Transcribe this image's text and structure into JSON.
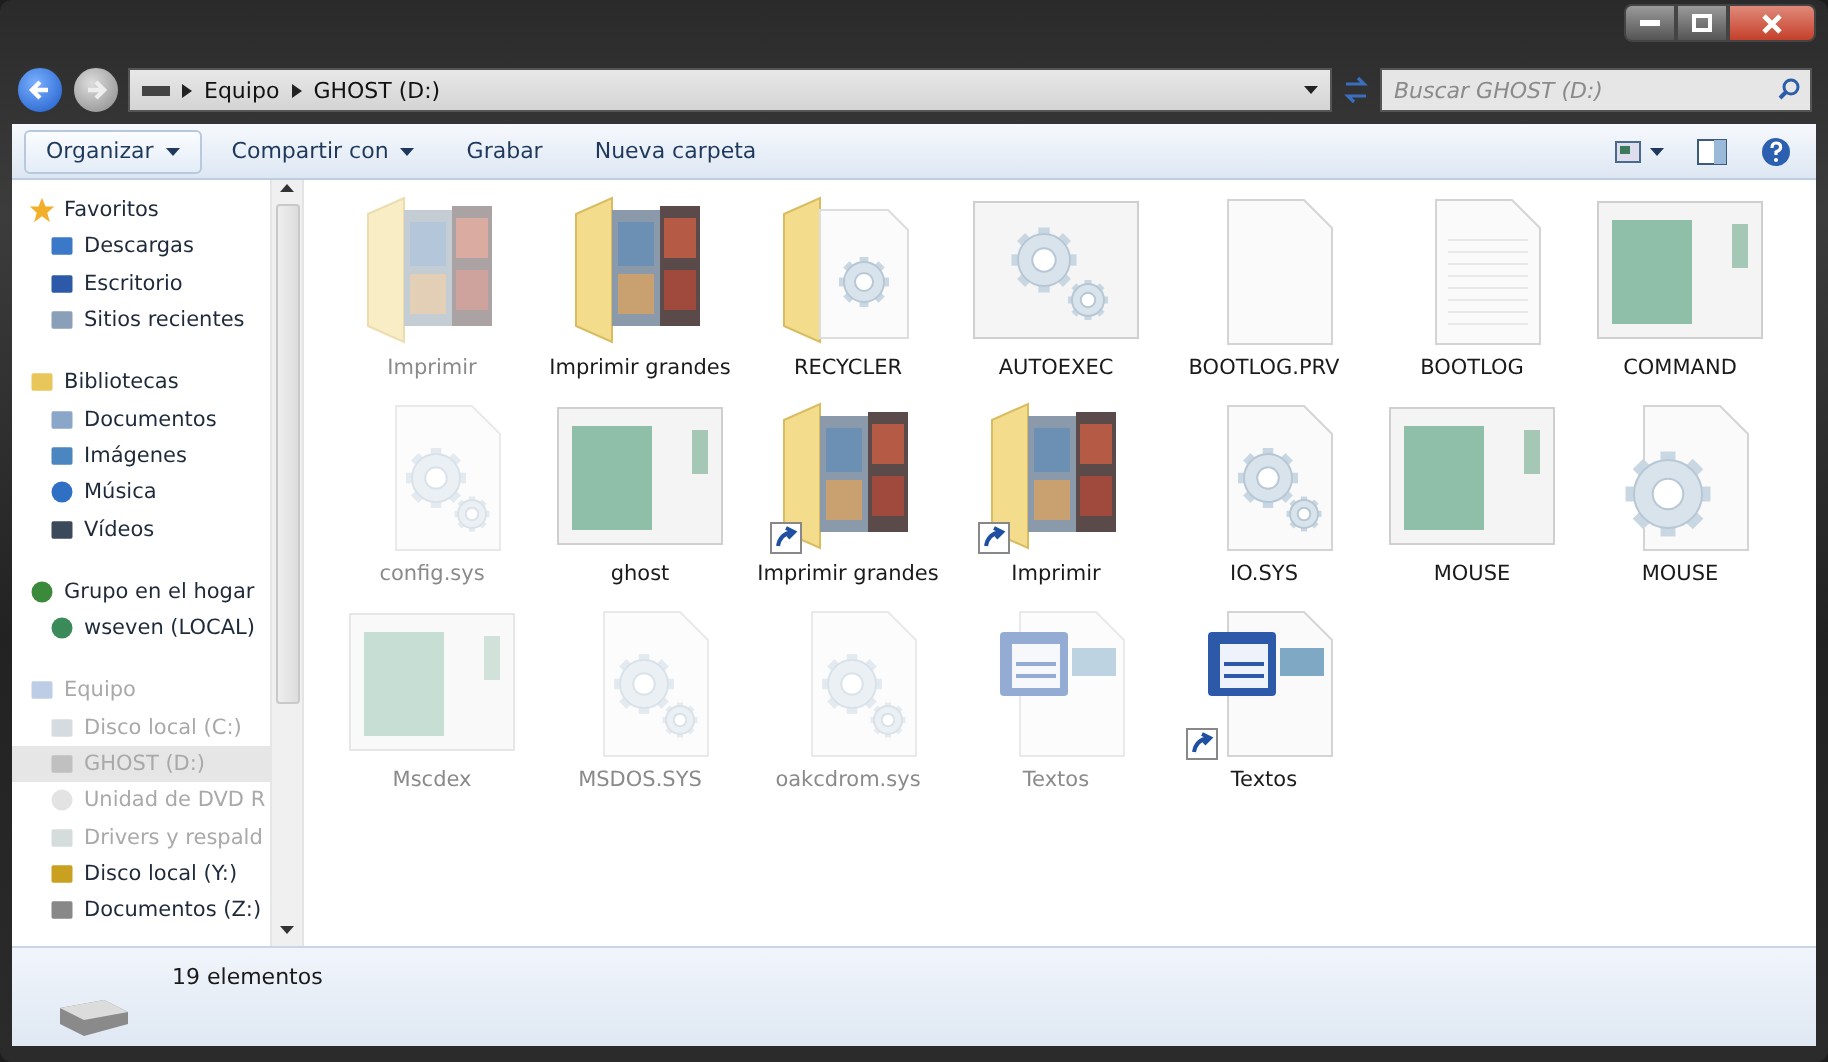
{
  "address": {
    "path": [
      "Equipo",
      "GHOST (D:)"
    ]
  },
  "search": {
    "placeholder": "Buscar GHOST (D:)"
  },
  "toolbar": [
    {
      "label": "Organizar",
      "dropdown": true
    },
    {
      "label": "Compartir con",
      "dropdown": true
    },
    {
      "label": "Grabar",
      "dropdown": false
    },
    {
      "label": "Nueva carpeta",
      "dropdown": false
    }
  ],
  "sidebar": [
    {
      "label": "Favoritos",
      "kind": "star",
      "disabled": false,
      "children": [
        {
          "label": "Descargas",
          "kind": "downloads",
          "disabled": false,
          "selected": false
        },
        {
          "label": "Escritorio",
          "kind": "desktop",
          "disabled": false,
          "selected": false
        },
        {
          "label": "Sitios recientes",
          "kind": "recent",
          "disabled": false,
          "selected": false
        }
      ]
    },
    {
      "label": "Bibliotecas",
      "kind": "library",
      "disabled": false,
      "children": [
        {
          "label": "Documentos",
          "kind": "document",
          "disabled": false,
          "selected": false
        },
        {
          "label": "Imágenes",
          "kind": "picture",
          "disabled": false,
          "selected": false
        },
        {
          "label": "Música",
          "kind": "music",
          "disabled": false,
          "selected": false
        },
        {
          "label": "Vídeos",
          "kind": "video",
          "disabled": false,
          "selected": false
        }
      ]
    },
    {
      "label": "Grupo en el hogar",
      "kind": "homegroup",
      "disabled": false,
      "children": [
        {
          "label": "wseven (LOCAL)",
          "kind": "user",
          "disabled": false,
          "selected": false
        }
      ]
    },
    {
      "label": "Equipo",
      "kind": "computer",
      "disabled": true,
      "children": [
        {
          "label": "Disco local (C:)",
          "kind": "disk",
          "disabled": true,
          "selected": false
        },
        {
          "label": "GHOST (D:)",
          "kind": "drive",
          "disabled": true,
          "selected": true
        },
        {
          "label": "Unidad de DVD R",
          "kind": "dvd",
          "disabled": true,
          "selected": false
        },
        {
          "label": "Drivers y respald",
          "kind": "netdrive",
          "disabled": true,
          "selected": false
        },
        {
          "label": "Disco local (Y:)",
          "kind": "lockdisk",
          "disabled": false,
          "selected": false
        },
        {
          "label": "Documentos (Z:)",
          "kind": "drive",
          "disabled": false,
          "selected": false
        }
      ]
    }
  ],
  "files": [
    {
      "name": "Imprimir",
      "kind": "photo-folder",
      "hidden": true,
      "shortcut": false
    },
    {
      "name": "Imprimir grandes",
      "kind": "photo-folder",
      "hidden": false,
      "shortcut": false
    },
    {
      "name": "RECYCLER",
      "kind": "gear-folder",
      "hidden": false,
      "shortcut": false
    },
    {
      "name": "AUTOEXEC",
      "kind": "gear-window",
      "hidden": false,
      "shortcut": false
    },
    {
      "name": "BOOTLOG.PRV",
      "kind": "blank-file",
      "hidden": false,
      "shortcut": false
    },
    {
      "name": "BOOTLOG",
      "kind": "text-file",
      "hidden": false,
      "shortcut": false
    },
    {
      "name": "COMMAND",
      "kind": "app-window",
      "hidden": false,
      "shortcut": false
    },
    {
      "name": "config.sys",
      "kind": "gear-file",
      "hidden": true,
      "shortcut": false
    },
    {
      "name": "ghost",
      "kind": "app-window",
      "hidden": false,
      "shortcut": false
    },
    {
      "name": "Imprimir grandes",
      "kind": "photo-folder",
      "hidden": false,
      "shortcut": true
    },
    {
      "name": "Imprimir",
      "kind": "photo-folder",
      "hidden": false,
      "shortcut": true
    },
    {
      "name": "IO.SYS",
      "kind": "gear-file",
      "hidden": false,
      "shortcut": false
    },
    {
      "name": "MOUSE",
      "kind": "app-window",
      "hidden": false,
      "shortcut": false
    },
    {
      "name": "MOUSE",
      "kind": "big-gear-file",
      "hidden": false,
      "shortcut": false
    },
    {
      "name": "Mscdex",
      "kind": "app-window",
      "hidden": true,
      "shortcut": false
    },
    {
      "name": "MSDOS.SYS",
      "kind": "gear-file",
      "hidden": true,
      "shortcut": false
    },
    {
      "name": "oakcdrom.sys",
      "kind": "gear-file",
      "hidden": true,
      "shortcut": false
    },
    {
      "name": "Textos",
      "kind": "word-doc",
      "hidden": true,
      "shortcut": false
    },
    {
      "name": "Textos",
      "kind": "word-doc",
      "hidden": false,
      "shortcut": true
    }
  ],
  "status_bar": {
    "count": "19 elementos"
  }
}
